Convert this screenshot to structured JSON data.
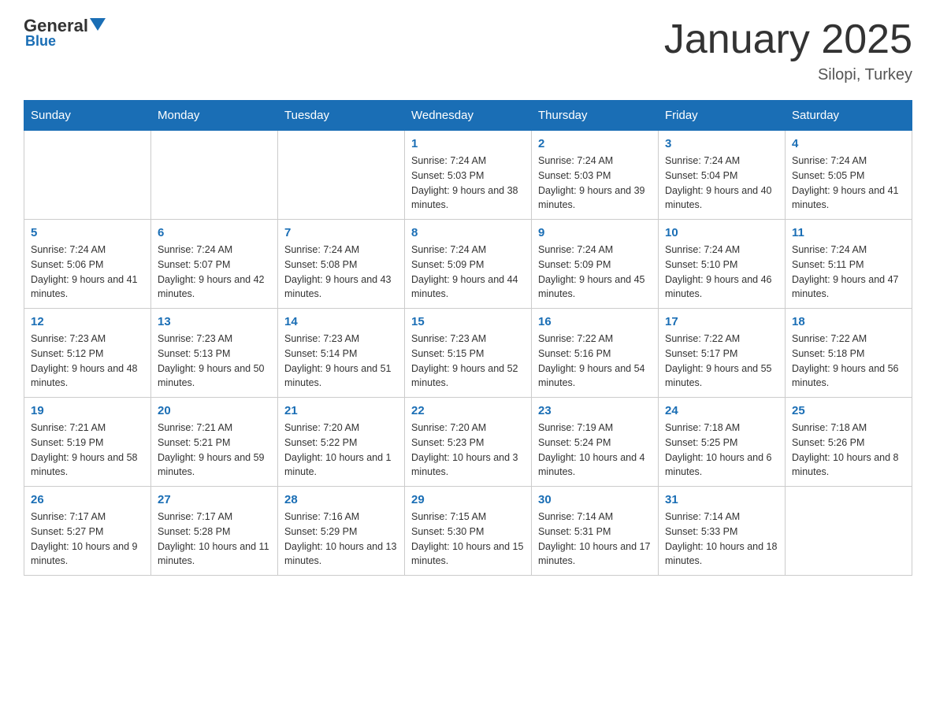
{
  "logo": {
    "general": "General",
    "blue": "Blue",
    "subtitle": "Blue"
  },
  "header": {
    "title": "January 2025",
    "subtitle": "Silopi, Turkey"
  },
  "weekdays": [
    "Sunday",
    "Monday",
    "Tuesday",
    "Wednesday",
    "Thursday",
    "Friday",
    "Saturday"
  ],
  "weeks": [
    [
      {
        "day": "",
        "info": ""
      },
      {
        "day": "",
        "info": ""
      },
      {
        "day": "",
        "info": ""
      },
      {
        "day": "1",
        "info": "Sunrise: 7:24 AM\nSunset: 5:03 PM\nDaylight: 9 hours and 38 minutes."
      },
      {
        "day": "2",
        "info": "Sunrise: 7:24 AM\nSunset: 5:03 PM\nDaylight: 9 hours and 39 minutes."
      },
      {
        "day": "3",
        "info": "Sunrise: 7:24 AM\nSunset: 5:04 PM\nDaylight: 9 hours and 40 minutes."
      },
      {
        "day": "4",
        "info": "Sunrise: 7:24 AM\nSunset: 5:05 PM\nDaylight: 9 hours and 41 minutes."
      }
    ],
    [
      {
        "day": "5",
        "info": "Sunrise: 7:24 AM\nSunset: 5:06 PM\nDaylight: 9 hours and 41 minutes."
      },
      {
        "day": "6",
        "info": "Sunrise: 7:24 AM\nSunset: 5:07 PM\nDaylight: 9 hours and 42 minutes."
      },
      {
        "day": "7",
        "info": "Sunrise: 7:24 AM\nSunset: 5:08 PM\nDaylight: 9 hours and 43 minutes."
      },
      {
        "day": "8",
        "info": "Sunrise: 7:24 AM\nSunset: 5:09 PM\nDaylight: 9 hours and 44 minutes."
      },
      {
        "day": "9",
        "info": "Sunrise: 7:24 AM\nSunset: 5:09 PM\nDaylight: 9 hours and 45 minutes."
      },
      {
        "day": "10",
        "info": "Sunrise: 7:24 AM\nSunset: 5:10 PM\nDaylight: 9 hours and 46 minutes."
      },
      {
        "day": "11",
        "info": "Sunrise: 7:24 AM\nSunset: 5:11 PM\nDaylight: 9 hours and 47 minutes."
      }
    ],
    [
      {
        "day": "12",
        "info": "Sunrise: 7:23 AM\nSunset: 5:12 PM\nDaylight: 9 hours and 48 minutes."
      },
      {
        "day": "13",
        "info": "Sunrise: 7:23 AM\nSunset: 5:13 PM\nDaylight: 9 hours and 50 minutes."
      },
      {
        "day": "14",
        "info": "Sunrise: 7:23 AM\nSunset: 5:14 PM\nDaylight: 9 hours and 51 minutes."
      },
      {
        "day": "15",
        "info": "Sunrise: 7:23 AM\nSunset: 5:15 PM\nDaylight: 9 hours and 52 minutes."
      },
      {
        "day": "16",
        "info": "Sunrise: 7:22 AM\nSunset: 5:16 PM\nDaylight: 9 hours and 54 minutes."
      },
      {
        "day": "17",
        "info": "Sunrise: 7:22 AM\nSunset: 5:17 PM\nDaylight: 9 hours and 55 minutes."
      },
      {
        "day": "18",
        "info": "Sunrise: 7:22 AM\nSunset: 5:18 PM\nDaylight: 9 hours and 56 minutes."
      }
    ],
    [
      {
        "day": "19",
        "info": "Sunrise: 7:21 AM\nSunset: 5:19 PM\nDaylight: 9 hours and 58 minutes."
      },
      {
        "day": "20",
        "info": "Sunrise: 7:21 AM\nSunset: 5:21 PM\nDaylight: 9 hours and 59 minutes."
      },
      {
        "day": "21",
        "info": "Sunrise: 7:20 AM\nSunset: 5:22 PM\nDaylight: 10 hours and 1 minute."
      },
      {
        "day": "22",
        "info": "Sunrise: 7:20 AM\nSunset: 5:23 PM\nDaylight: 10 hours and 3 minutes."
      },
      {
        "day": "23",
        "info": "Sunrise: 7:19 AM\nSunset: 5:24 PM\nDaylight: 10 hours and 4 minutes."
      },
      {
        "day": "24",
        "info": "Sunrise: 7:18 AM\nSunset: 5:25 PM\nDaylight: 10 hours and 6 minutes."
      },
      {
        "day": "25",
        "info": "Sunrise: 7:18 AM\nSunset: 5:26 PM\nDaylight: 10 hours and 8 minutes."
      }
    ],
    [
      {
        "day": "26",
        "info": "Sunrise: 7:17 AM\nSunset: 5:27 PM\nDaylight: 10 hours and 9 minutes."
      },
      {
        "day": "27",
        "info": "Sunrise: 7:17 AM\nSunset: 5:28 PM\nDaylight: 10 hours and 11 minutes."
      },
      {
        "day": "28",
        "info": "Sunrise: 7:16 AM\nSunset: 5:29 PM\nDaylight: 10 hours and 13 minutes."
      },
      {
        "day": "29",
        "info": "Sunrise: 7:15 AM\nSunset: 5:30 PM\nDaylight: 10 hours and 15 minutes."
      },
      {
        "day": "30",
        "info": "Sunrise: 7:14 AM\nSunset: 5:31 PM\nDaylight: 10 hours and 17 minutes."
      },
      {
        "day": "31",
        "info": "Sunrise: 7:14 AM\nSunset: 5:33 PM\nDaylight: 10 hours and 18 minutes."
      },
      {
        "day": "",
        "info": ""
      }
    ]
  ]
}
